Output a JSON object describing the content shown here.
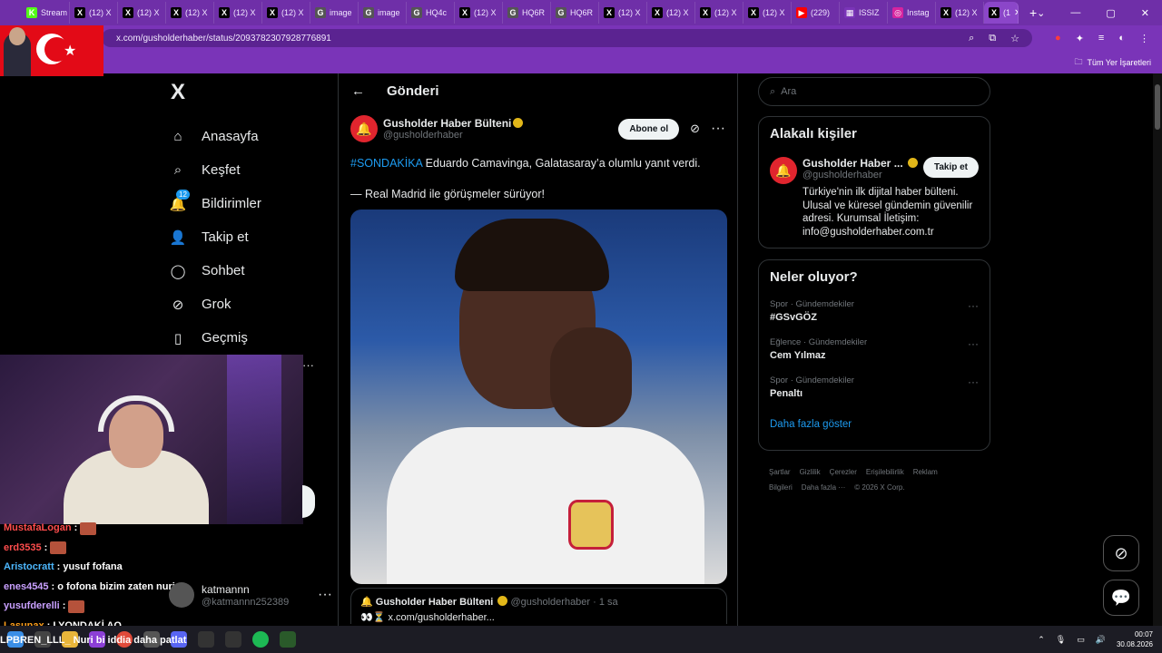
{
  "browser": {
    "tabs": [
      {
        "label": "Stream",
        "icon": "K",
        "color": "#53fc18"
      },
      {
        "label": "(12) X",
        "icon": "X",
        "color": "#000000"
      },
      {
        "label": "(12) X",
        "icon": "X",
        "color": "#000000"
      },
      {
        "label": "(12) X",
        "icon": "X",
        "color": "#000000"
      },
      {
        "label": "(12) X",
        "icon": "X",
        "color": "#000000"
      },
      {
        "label": "(12) X",
        "icon": "X",
        "color": "#000000"
      },
      {
        "label": "image",
        "icon": "G",
        "color": "#555555"
      },
      {
        "label": "image",
        "icon": "G",
        "color": "#555555"
      },
      {
        "label": "HQ4c",
        "icon": "G",
        "color": "#555555"
      },
      {
        "label": "(12) X",
        "icon": "X",
        "color": "#000000"
      },
      {
        "label": "HQ6R",
        "icon": "G",
        "color": "#555555"
      },
      {
        "label": "HQ6R",
        "icon": "G",
        "color": "#555555"
      },
      {
        "label": "(12) X",
        "icon": "X",
        "color": "#000000"
      },
      {
        "label": "(12) X",
        "icon": "X",
        "color": "#000000"
      },
      {
        "label": "(12) X",
        "icon": "X",
        "color": "#000000"
      },
      {
        "label": "(12) X",
        "icon": "X",
        "color": "#000000"
      },
      {
        "label": "(229)",
        "icon": "▶",
        "color": "#ff0000"
      },
      {
        "label": "ISSIZ",
        "icon": "▦",
        "color": "#7a34b8"
      },
      {
        "label": "Instag",
        "icon": "◎",
        "color": "#d6249f"
      },
      {
        "label": "(12) X",
        "icon": "X",
        "color": "#000000"
      }
    ],
    "active_tab": "(1",
    "url": "x.com/gusholderhaber/status/2093782307928776891",
    "bookmarks_label": "Tüm Yer İşaretleri"
  },
  "nav": {
    "logo": "X",
    "items": [
      {
        "label": "Anasayfa",
        "icon": "⌂"
      },
      {
        "label": "Keşfet",
        "icon": "⌕"
      },
      {
        "label": "Bildirimler",
        "icon": "🔔",
        "badge": "12"
      },
      {
        "label": "Takip et",
        "icon": "👤"
      },
      {
        "label": "Sohbet",
        "icon": "◯"
      },
      {
        "label": "Grok",
        "icon": "⊘"
      },
      {
        "label": "Geçmiş",
        "icon": "▯"
      }
    ]
  },
  "account": {
    "name": "katmannn",
    "handle": "@katmannn252389"
  },
  "chat": [
    {
      "user": "MustafaLogan",
      "color": "#ff4d4d",
      "msg": ":",
      "emote": true
    },
    {
      "user": "erd3535",
      "color": "#ff4d4d",
      "msg": ":",
      "emote": true
    },
    {
      "user": "Aristocratt",
      "color": "#4db8ff",
      "msg": ": yusuf fofana",
      "emote": false
    },
    {
      "user": "enes4545",
      "color": "#c9a0ff",
      "msg": ": o fofona bizim zaten nuri",
      "emote": false
    },
    {
      "user": "yusufderelli",
      "color": "#c9a0ff",
      "msg": ":",
      "emote": true
    },
    {
      "user": "Lasunax",
      "color": "#ff9f1a",
      "msg": ": LYONDAKİ AQ",
      "emote": false
    }
  ],
  "marquee": "LPBREN_LLL_ Nuri bi iddia daha patlat",
  "main": {
    "header": "Gönderi",
    "post": {
      "name": "Gusholder Haber Bülteni",
      "handle": "@gusholderhaber",
      "subscribe": "Abone ol",
      "hashtag": "#SONDAKİKA",
      "text1": " Eduardo Camavinga, Galatasaray’a olumlu yanıt verdi.",
      "text2": "— Real Madrid ile görüşmeler sürüyor!"
    },
    "quote": {
      "name": "Gusholder Haber Bülteni",
      "handle": "@gusholderhaber · 1 sa",
      "text": "👀⏳ x.com/gusholderhaber..."
    }
  },
  "right": {
    "search_placeholder": "Ara",
    "related_title": "Alakalı kişiler",
    "related": {
      "name": "Gusholder Haber ...",
      "handle": "@gusholderhaber",
      "button": "Takip et",
      "bio": "Türkiye'nin ilk dijital haber bülteni. Ulusal ve küresel gündemin güvenilir adresi. Kurumsal İletişim: info@gusholderhaber.com.tr"
    },
    "trends_title": "Neler oluyor?",
    "trends": [
      {
        "cat": "Spor · Gündemdekiler",
        "title": "#GSvGÖZ"
      },
      {
        "cat": "Eğlence · Gündemdekiler",
        "title": "Cem Yılmaz"
      },
      {
        "cat": "Spor · Gündemdekiler",
        "title": "Penaltı"
      }
    ],
    "show_more": "Daha fazla göster",
    "footer": [
      "Şartlar",
      "Gizlilik",
      "Çerezler",
      "Erişilebilirlik",
      "Reklam Bilgileri",
      "Daha fazla ···",
      "© 2026 X Corp."
    ]
  },
  "taskbar": {
    "time": "00:07",
    "date": "30.08.2026"
  }
}
